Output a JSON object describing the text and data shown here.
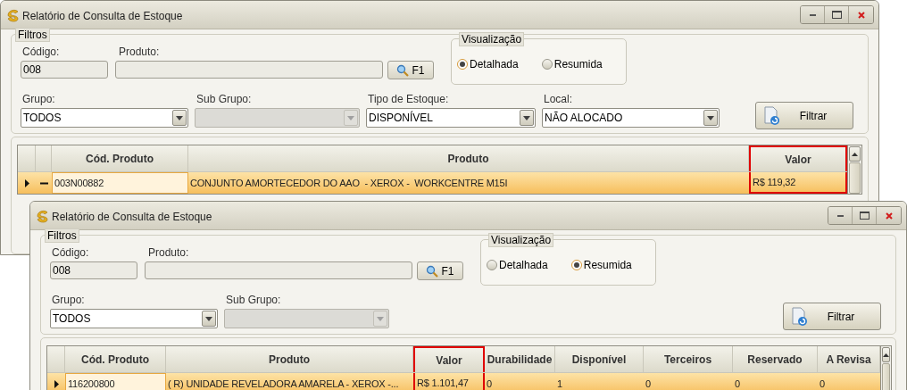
{
  "windows": [
    {
      "title": "Relatório de Consulta de Estoque",
      "filters": {
        "title": "Filtros",
        "codigo": {
          "label": "Código:",
          "value": "008"
        },
        "produto": {
          "label": "Produto:"
        },
        "search_button": "F1",
        "view": {
          "title": "Visualização",
          "options": [
            {
              "label": "Detalhada",
              "selected": true
            },
            {
              "label": "Resumida",
              "selected": false
            }
          ]
        },
        "combos": [
          {
            "label": "Grupo:",
            "value": "TODOS",
            "disabled": false
          },
          {
            "label": "Sub Grupo:",
            "disabled": true
          },
          {
            "label": "Tipo de Estoque:",
            "value": "DISPONÍVEL",
            "disabled": false
          },
          {
            "label": "Local:",
            "value": "NÃO ALOCADO",
            "disabled": false
          }
        ],
        "filter_button": "Filtrar"
      },
      "grid": {
        "columns": [
          {
            "label": "Cód. Produto",
            "highlighted": false
          },
          {
            "label": "Produto",
            "highlighted": false
          },
          {
            "label": "Valor",
            "highlighted": true
          }
        ],
        "rows": [
          {
            "selected": true,
            "expanded": true,
            "cells": [
              "003N00882",
              "CONJUNTO AMORTECEDOR DO AAO  - XEROX -  WORKCENTRE M15I",
              "R$ 119,32"
            ]
          }
        ]
      }
    },
    {
      "title": "Relatório de Consulta de Estoque",
      "filters": {
        "title": "Filtros",
        "codigo": {
          "label": "Código:",
          "value": "008"
        },
        "produto": {
          "label": "Produto:"
        },
        "search_button": "F1",
        "view": {
          "title": "Visualização",
          "options": [
            {
              "label": "Detalhada",
              "selected": false
            },
            {
              "label": "Resumida",
              "selected": true
            }
          ]
        },
        "combos": [
          {
            "label": "Grupo:",
            "value": "TODOS",
            "disabled": false
          },
          {
            "label": "Sub Grupo:",
            "disabled": true
          }
        ],
        "filter_button": "Filtrar"
      },
      "grid": {
        "columns": [
          {
            "label": "Cód. Produto",
            "highlighted": false
          },
          {
            "label": "Produto",
            "highlighted": false
          },
          {
            "label": "Valor",
            "highlighted": true
          },
          {
            "label": "Durabilidade",
            "highlighted": false
          },
          {
            "label": "Disponível",
            "highlighted": false
          },
          {
            "label": "Terceiros",
            "highlighted": false
          },
          {
            "label": "Reservado",
            "highlighted": false
          },
          {
            "label": "A Revisa",
            "highlighted": false
          }
        ],
        "rows": [
          {
            "selected": true,
            "cells": [
              "116200800",
              "( R) UNIDADE REVELADORA AMARELA - XEROX -...",
              "R$ 1.101,47",
              "0",
              "1",
              "0",
              "0",
              "0"
            ]
          }
        ]
      }
    }
  ]
}
